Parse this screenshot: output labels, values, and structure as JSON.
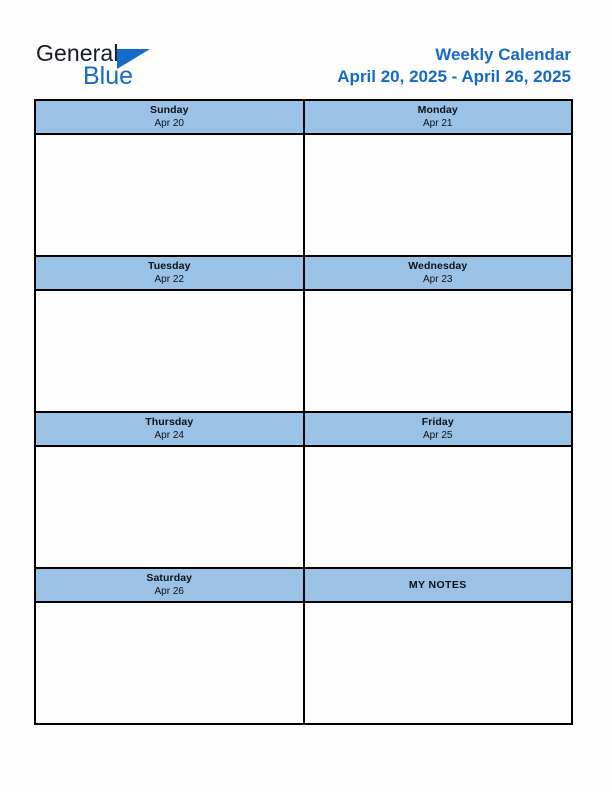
{
  "brand": {
    "name_primary": "General",
    "name_secondary": "Blue",
    "primary_color": "#161c22",
    "accent_color": "#1569c7",
    "triangle_icon": "triangle-right-icon"
  },
  "header": {
    "title": "Weekly Calendar",
    "date_range": "April 20, 2025 - April 26, 2025",
    "title_color": "#1569c7"
  },
  "calendar": {
    "header_band_color": "#9ac1e6",
    "border_color": "#000000",
    "cell_background": "#fdfdfd",
    "notes_label": "MY NOTES",
    "rows": [
      [
        {
          "day": "Sunday",
          "date": "Apr 20",
          "content": ""
        },
        {
          "day": "Monday",
          "date": "Apr 21",
          "content": ""
        }
      ],
      [
        {
          "day": "Tuesday",
          "date": "Apr 22",
          "content": ""
        },
        {
          "day": "Wednesday",
          "date": "Apr 23",
          "content": ""
        }
      ],
      [
        {
          "day": "Thursday",
          "date": "Apr 24",
          "content": ""
        },
        {
          "day": "Friday",
          "date": "Apr 25",
          "content": ""
        }
      ],
      [
        {
          "day": "Saturday",
          "date": "Apr 26",
          "content": ""
        }
      ]
    ]
  }
}
